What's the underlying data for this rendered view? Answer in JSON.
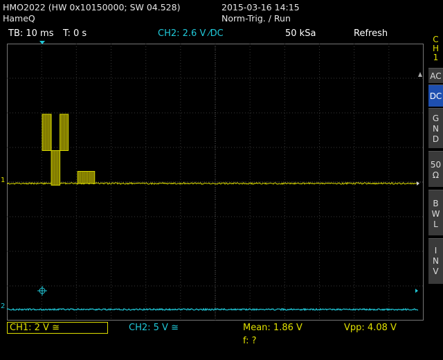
{
  "header": {
    "model": "HMO2022 (HW 0x10150000; SW 04.528)",
    "name": "HameQ",
    "datetime": "2015-03-16 14:15",
    "status": "Norm-Trig. / Run"
  },
  "topbar": {
    "timebase": "TB: 10 ms",
    "trigger_time": "T: 0 s",
    "trigger": "CH2: 2.6 V ⁄DC",
    "samplerate": "50 kSa",
    "mode": "Refresh"
  },
  "side_menu": {
    "channel": [
      "C",
      "H",
      "1"
    ],
    "ac": "AC",
    "dc": "DC",
    "gnd": [
      "G",
      "N",
      "D"
    ],
    "ohm": [
      "50",
      "Ω"
    ],
    "bwl": [
      "B",
      "W",
      "L"
    ],
    "inv": [
      "I",
      "N",
      "V"
    ]
  },
  "bottom": {
    "ch1": "CH1: 2 V ≅",
    "ch2": "CH2: 5 V ≅",
    "mean": "Mean: 1.86 V",
    "vpp": "Vpp: 4.08 V",
    "freq": "f: ?"
  },
  "markers": {
    "ch1": "1",
    "ch2": "2"
  },
  "colors": {
    "ch1": "#d8d800",
    "ch1_fill": "#7a7400",
    "ch2": "#20c8d8",
    "accent": "#1e4fb0"
  },
  "chart_data": {
    "type": "line",
    "x_unit": "ms",
    "time_per_div": 10,
    "volts_per_div_ch1": 2,
    "volts_per_div_ch2": 5,
    "ch1_bursts": [
      {
        "t_start": 5,
        "t_end": 7.6,
        "v_top": 4.0,
        "v_bottom": 1.9
      },
      {
        "t_start": 7.6,
        "t_end": 10.1,
        "v_top": 1.9,
        "v_bottom": -0.1
      },
      {
        "t_start": 10.1,
        "t_end": 12.5,
        "v_top": 4.0,
        "v_bottom": 1.9
      },
      {
        "t_start": 15.2,
        "t_end": 20.1,
        "v_top": 0.7,
        "v_bottom": 0
      }
    ]
  }
}
